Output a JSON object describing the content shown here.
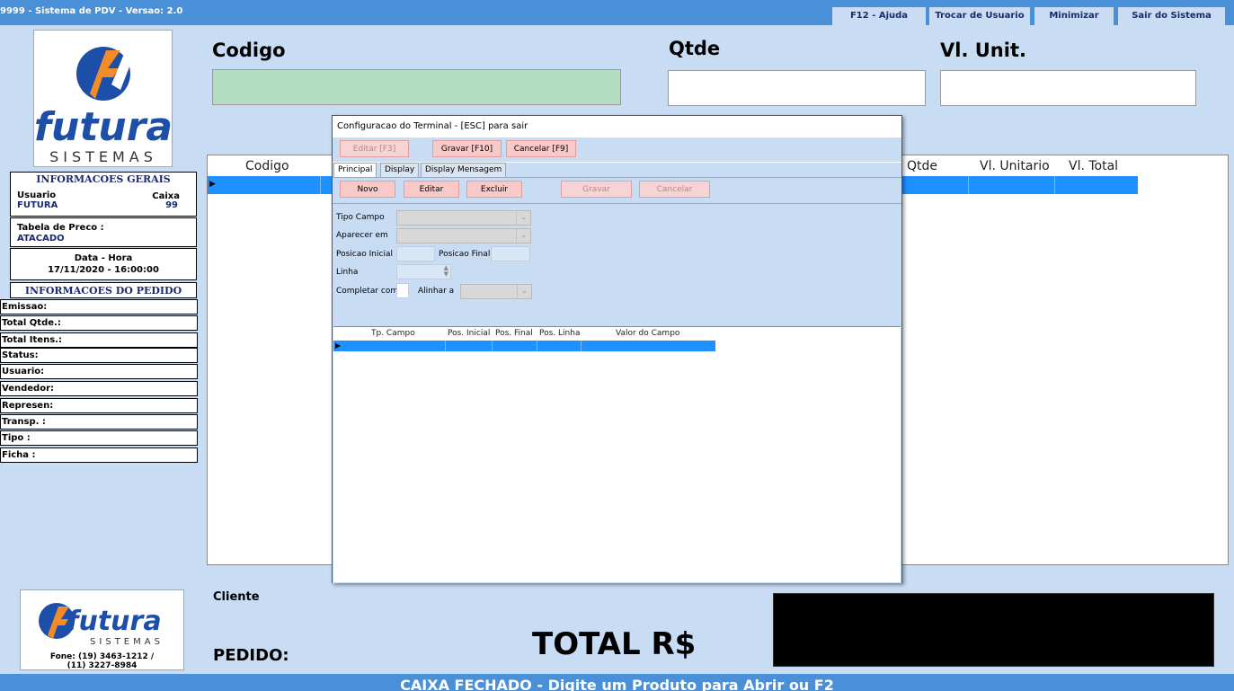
{
  "titlebar": {
    "app_title": "9999 - Sistema de PDV - Versao: 2.0",
    "help": "F12 - Ajuda",
    "switch_user": "Trocar de Usuario",
    "minimize": "Minimizar",
    "exit": "Sair do Sistema"
  },
  "logo": {
    "name": "futura",
    "tagline": "SISTEMAS"
  },
  "sidebar": {
    "general_header": "INFORMACOES GERAIS",
    "user_label": "Usuario",
    "user_value": "FUTURA",
    "register_label": "Caixa",
    "register_value": "99",
    "price_table_label": "Tabela de Preco :",
    "price_table_value": "ATACADO",
    "datetime_label": "Data - Hora",
    "datetime_value": "17/11/2020 - 16:00:00",
    "order_header": "INFORMACOES DO PEDIDO",
    "order_fields": [
      "Emissao:",
      "Total Qtde.:",
      "Total Itens.:",
      "Status:",
      "Usuario:",
      "Vendedor:",
      "Represen:",
      "Transp. :",
      "Tipo :",
      "Ficha :"
    ],
    "phone": "Fone: (19) 3463-1212 /",
    "phone2": "(11) 3227-8984"
  },
  "main": {
    "code_label": "Codigo",
    "qty_label": "Qtde",
    "unit_label": "Vl. Unit.",
    "grid_headers": [
      "Codigo",
      "Qtde",
      "Vl. Unitario",
      "Vl. Total"
    ],
    "client_label": "Cliente",
    "order_label": "PEDIDO:",
    "total_label": "TOTAL R$",
    "status": "CAIXA FECHADO - Digite um Produto para Abrir ou F2"
  },
  "dialog": {
    "title": "Configuracao do Terminal - [ESC] para sair",
    "edit_f3": "Editar [F3]",
    "save_f10": "Gravar [F10]",
    "cancel_f9": "Cancelar [F9]",
    "tabs": [
      "Principal",
      "Display",
      "Display Mensagem"
    ],
    "new": "Novo",
    "edit": "Editar",
    "delete": "Excluir",
    "save": "Gravar",
    "cancel": "Cancelar",
    "field_type": "Tipo Campo",
    "appear_in": "Aparecer em",
    "start_pos": "Posicao Inicial",
    "end_pos": "Posicao Final",
    "line": "Linha",
    "complete_with": "Completar com",
    "align_to": "Alinhar a",
    "grid_headers": [
      "Tp. Campo",
      "Pos. Inicial",
      "Pos. Final",
      "Pos. Linha",
      "Valor do Campo"
    ]
  },
  "colors": {
    "bg": "#c8dcf4",
    "accent": "#4a90d9",
    "selection": "#1e90ff",
    "code_field": "#b4dcc0"
  }
}
